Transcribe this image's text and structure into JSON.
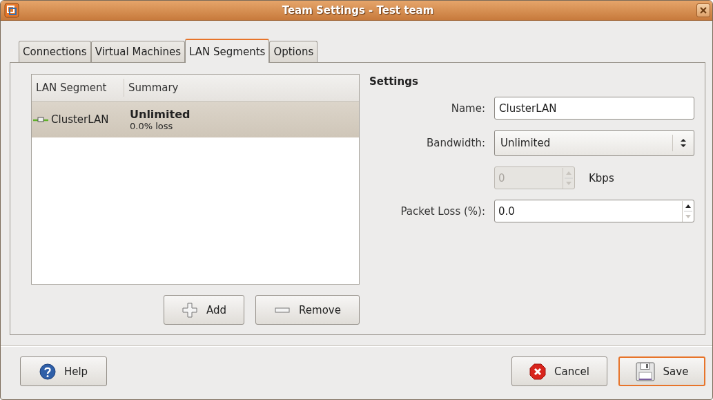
{
  "window": {
    "title": "Team Settings - Test team"
  },
  "tabs": [
    {
      "label": "Connections",
      "selected": false
    },
    {
      "label": "Virtual Machines",
      "selected": false
    },
    {
      "label": "LAN Segments",
      "selected": true
    },
    {
      "label": "Options",
      "selected": false
    }
  ],
  "list": {
    "columns": [
      {
        "label": "LAN Segment"
      },
      {
        "label": "Summary"
      }
    ],
    "rows": [
      {
        "name": "ClusterLAN",
        "summary_title": "Unlimited",
        "summary_detail": "0.0% loss",
        "selected": true
      }
    ]
  },
  "list_buttons": [
    {
      "kind": "add",
      "label": "Add"
    },
    {
      "kind": "remove",
      "label": "Remove"
    }
  ],
  "settings": {
    "heading": "Settings",
    "name": {
      "label": "Name:",
      "value": "ClusterLAN"
    },
    "bandwidth": {
      "label": "Bandwidth:",
      "value": "Unlimited"
    },
    "rate": {
      "value": "0",
      "disabled": true,
      "unit": "Kbps"
    },
    "packet_loss": {
      "label": "Packet Loss (%):",
      "value": "0.0"
    }
  },
  "footer_buttons": [
    {
      "kind": "help",
      "label": "Help",
      "focused": false
    },
    {
      "kind": "cancel",
      "label": "Cancel",
      "focused": false
    },
    {
      "kind": "save",
      "label": "Save",
      "focused": true
    }
  ]
}
